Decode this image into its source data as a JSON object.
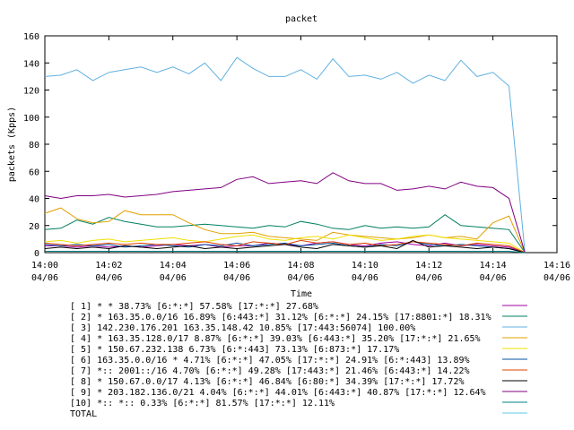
{
  "chart_data": {
    "type": "line",
    "title": "packet",
    "xlabel": "Time",
    "ylabel": "packets (Kpps)",
    "ylim": [
      0,
      160
    ],
    "yticks": [
      0,
      20,
      40,
      60,
      80,
      100,
      120,
      140,
      160
    ],
    "xlim": [
      "14:00",
      "14:16"
    ],
    "xticks": [
      {
        "time": "14:00",
        "date": "04/06"
      },
      {
        "time": "14:02",
        "date": "04/06"
      },
      {
        "time": "14:04",
        "date": "04/06"
      },
      {
        "time": "14:06",
        "date": "04/06"
      },
      {
        "time": "14:08",
        "date": "04/06"
      },
      {
        "time": "14:10",
        "date": "04/06"
      },
      {
        "time": "14:12",
        "date": "04/06"
      },
      {
        "time": "14:14",
        "date": "04/06"
      },
      {
        "time": "14:16",
        "date": "04/06"
      }
    ],
    "grid": false,
    "legend_position": "bottom",
    "x": [
      "14:00:00",
      "14:00:30",
      "14:01:00",
      "14:01:30",
      "14:02:00",
      "14:02:30",
      "14:03:00",
      "14:03:30",
      "14:04:00",
      "14:04:30",
      "14:05:00",
      "14:05:30",
      "14:06:00",
      "14:06:30",
      "14:07:00",
      "14:07:30",
      "14:08:00",
      "14:08:30",
      "14:09:00",
      "14:09:30",
      "14:10:00",
      "14:10:30",
      "14:11:00",
      "14:11:30",
      "14:12:00",
      "14:12:30",
      "14:13:00",
      "14:13:30",
      "14:14:00",
      "14:14:30",
      "14:15:00"
    ],
    "series": [
      {
        "name": "[ 1] * * 38.73%  [6:*:*] 57.58% [17:*:*] 27.68%",
        "color": "#a000a0",
        "values": [
          5,
          5,
          4,
          5,
          4,
          5,
          4,
          5,
          6,
          5,
          6,
          4,
          5,
          5,
          7,
          6,
          5,
          7,
          8,
          6,
          5,
          7,
          8,
          6,
          5,
          7,
          5,
          6,
          5,
          4,
          0
        ]
      },
      {
        "name": "[ 2] * 163.35.0.0/16 16.89%  [6:443:*] 31.12% [6:*:*] 24.15% [17:8801:*] 18.31%",
        "color": "#008060",
        "values": [
          17,
          18,
          24,
          21,
          26,
          23,
          21,
          19,
          19,
          20,
          21,
          20,
          19,
          18,
          20,
          19,
          23,
          21,
          18,
          17,
          20,
          18,
          19,
          18,
          19,
          28,
          20,
          19,
          18,
          17,
          0
        ]
      },
      {
        "name": "[ 3] 142.230.176.201 163.35.148.42 10.85%  [17:443:56074] 100.00%",
        "color": "#60b0e0",
        "values": [
          130,
          131,
          135,
          127,
          133,
          135,
          137,
          133,
          137,
          132,
          140,
          127,
          144,
          136,
          130,
          130,
          135,
          128,
          143,
          130,
          131,
          128,
          133,
          125,
          131,
          127,
          142,
          130,
          133,
          123,
          0
        ]
      },
      {
        "name": "[ 4] * 163.35.128.0/17 8.87%  [6:*:*] 39.03% [6:443:*] 35.20% [17:*:*] 21.65%",
        "color": "#e0a000",
        "values": [
          29,
          33,
          25,
          22,
          23,
          31,
          28,
          28,
          28,
          22,
          17,
          14,
          14,
          15,
          12,
          11,
          10,
          9,
          15,
          13,
          12,
          11,
          10,
          11,
          13,
          11,
          12,
          10,
          22,
          27,
          0
        ]
      },
      {
        "name": "[ 5] * 150.67.232.138 6.73%  [6:*:443] 73.13% [6:873:*] 17.17%",
        "color": "#f0e000",
        "values": [
          8,
          9,
          7,
          9,
          10,
          8,
          9,
          10,
          11,
          9,
          8,
          10,
          12,
          13,
          10,
          9,
          11,
          12,
          10,
          13,
          11,
          9,
          10,
          12,
          13,
          11,
          10,
          9,
          8,
          7,
          0
        ]
      },
      {
        "name": "[ 6] 163.35.0.0/16 * 4.71%  [6:*:*] 47.05% [17:*:*] 24.91% [6:*:443] 13.89%",
        "color": "#0050a0",
        "values": [
          6,
          5,
          6,
          5,
          6,
          4,
          5,
          6,
          5,
          4,
          6,
          5,
          7,
          5,
          6,
          7,
          5,
          6,
          7,
          5,
          4,
          6,
          5,
          8,
          6,
          5,
          6,
          5,
          4,
          3,
          0
        ]
      },
      {
        "name": "[ 7] *:: 2001::/16 4.70%  [6:*:*] 49.28% [17:443:*] 21.46% [6:443:*] 14.22%",
        "color": "#e04000",
        "values": [
          7,
          6,
          5,
          6,
          7,
          6,
          7,
          6,
          6,
          7,
          8,
          6,
          5,
          8,
          7,
          6,
          9,
          7,
          8,
          6,
          7,
          5,
          6,
          8,
          7,
          6,
          5,
          7,
          6,
          5,
          0
        ]
      },
      {
        "name": "[ 8] * 150.67.0.0/17 4.13%  [6:*:*] 46.84% [6:80:*] 34.39% [17:*:*] 17.72%",
        "color": "#000000",
        "values": [
          3,
          4,
          3,
          4,
          3,
          5,
          4,
          3,
          4,
          5,
          3,
          4,
          3,
          4,
          5,
          6,
          4,
          3,
          6,
          5,
          4,
          5,
          3,
          9,
          4,
          5,
          4,
          3,
          4,
          3,
          0
        ]
      },
      {
        "name": "[ 9] * 203.182.136.0/21 4.04%  [6:*:*] 44.01% [6:443:*] 40.87% [17:*:*] 12.64%",
        "color": "#800080",
        "values": [
          42,
          40,
          42,
          42,
          43,
          41,
          42,
          43,
          45,
          46,
          47,
          48,
          54,
          56,
          51,
          52,
          53,
          51,
          59,
          53,
          51,
          51,
          46,
          47,
          49,
          47,
          52,
          49,
          48,
          40,
          0
        ]
      },
      {
        "name": "[10] *:: *:: 0.33%  [6:*:*] 81.57% [17:*:*] 12.11%",
        "color": "#008080",
        "values": [
          1,
          1,
          1,
          1,
          1,
          1,
          1,
          1,
          1,
          1,
          1,
          1,
          1,
          1,
          1,
          1,
          1,
          1,
          1,
          1,
          1,
          1,
          1,
          1,
          1,
          1,
          1,
          1,
          1,
          1,
          0
        ]
      }
    ],
    "total": {
      "name": "TOTAL",
      "color": "#60c8e8"
    }
  }
}
